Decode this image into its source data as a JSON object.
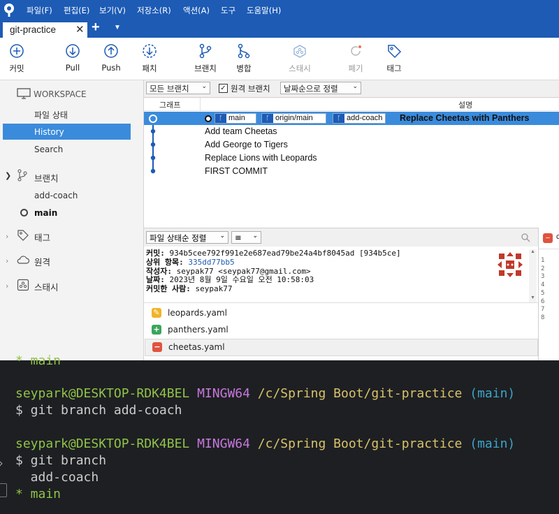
{
  "menu": [
    "파일(F)",
    "편집(E)",
    "보기(V)",
    "저장소(R)",
    "액션(A)",
    "도구",
    "도움말(H)"
  ],
  "tab": {
    "title": "git-practice"
  },
  "toolbar": {
    "commit": "커밋",
    "pull": "Pull",
    "push": "Push",
    "fetch": "패치",
    "branch": "브랜치",
    "merge": "병합",
    "stash": "스태시",
    "discard": "폐기",
    "tag": "태그"
  },
  "sidebar": {
    "workspace": "WORKSPACE",
    "file_status": "파일 상태",
    "history": "History",
    "search": "Search",
    "branches": "브랜치",
    "branch_items": [
      "add-coach",
      "main"
    ],
    "tags": "태그",
    "remotes": "원격",
    "stashes": "스태시"
  },
  "filters": {
    "all_branches": "모든 브랜치",
    "remote_branches": "원격 브랜치",
    "sort": "날짜순으로 정렬"
  },
  "columns": {
    "graph": "그래프",
    "description": "설명"
  },
  "commits": [
    {
      "badges": [
        "main",
        "origin/main",
        "add-coach"
      ],
      "message": "Replace Cheetas with Panthers",
      "selected": true
    },
    {
      "message": "Add team Cheetas"
    },
    {
      "message": "Add George to Tigers"
    },
    {
      "message": "Replace Lions with Leopards"
    },
    {
      "message": "FIRST COMMIT"
    }
  ],
  "lower": {
    "sort": "파일 상태순 정렬",
    "view": "≡"
  },
  "details": {
    "commit_label": "커밋:",
    "commit_value": "934b5cee792f991e2e687ead79be24a4bf8045ad [934b5ce]",
    "parent_label": "상위 항목:",
    "parent_value": "335dd77bb5",
    "author_label": "작성자:",
    "author_value": "seypak77 <seypak77@gmail.com>",
    "date_label": "날짜:",
    "date_value": "2023년 8월 9일 수요일 오전 10:58:03",
    "committer_label": "커밋한 사람:",
    "committer_value": "seypak77"
  },
  "files": [
    {
      "name": "leopards.yaml",
      "status": "modified"
    },
    {
      "name": "panthers.yaml",
      "status": "added"
    },
    {
      "name": "cheetas.yaml",
      "status": "removed"
    }
  ],
  "right_panel": {
    "prefix": "c",
    "lines": [
      "1",
      "2",
      "3",
      "4",
      "5",
      "6",
      "7",
      "8"
    ]
  },
  "terminal": {
    "top_line": "* main",
    "user": "seypark@DESKTOP-RDK4BEL",
    "env": "MINGW64",
    "path": "/c/Spring Boot/git-practice",
    "branch": "(main)",
    "cmd1": "$ git branch add-coach",
    "cmd2": "$ git branch",
    "out1": "  add-coach",
    "out2": "* main"
  },
  "colors": {
    "accent": "#1d5bb5",
    "selection": "#3b8bdc",
    "terminal_bg": "#1e1f22"
  }
}
